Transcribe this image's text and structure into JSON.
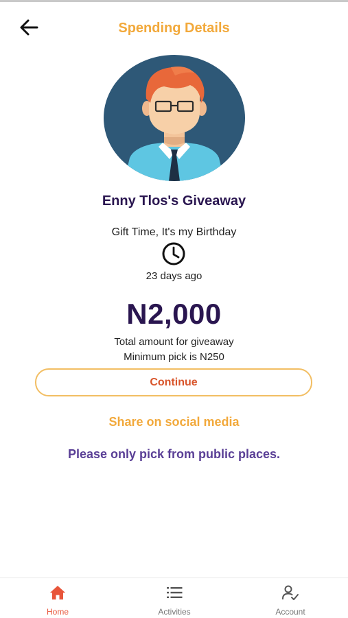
{
  "header": {
    "title": "Spending Details",
    "back_icon": "arrow-left-icon"
  },
  "giveaway": {
    "title": "Enny Tlos's Giveaway",
    "message": "Gift Time, It's my Birthday",
    "clock_icon": "clock-icon",
    "time_ago": "23 days ago",
    "amount": "N2,000",
    "amount_label": "Total amount for giveaway",
    "minimum_pick": "Minimum pick is N250"
  },
  "actions": {
    "continue_label": "Continue",
    "share_label": "Share on social media"
  },
  "notice": "Please only pick from public places.",
  "bottom_nav": {
    "items": [
      {
        "label": "Home",
        "icon": "home-icon",
        "active": true
      },
      {
        "label": "Activities",
        "icon": "list-icon",
        "active": false
      },
      {
        "label": "Account",
        "icon": "user-check-icon",
        "active": false
      }
    ]
  },
  "colors": {
    "accent_orange": "#f2a93b",
    "title_dark": "#2a1650",
    "button_text": "#d8542a",
    "notice_purple": "#5a3f96",
    "nav_active": "#e8553a",
    "avatar_bg": "#2e5877"
  }
}
